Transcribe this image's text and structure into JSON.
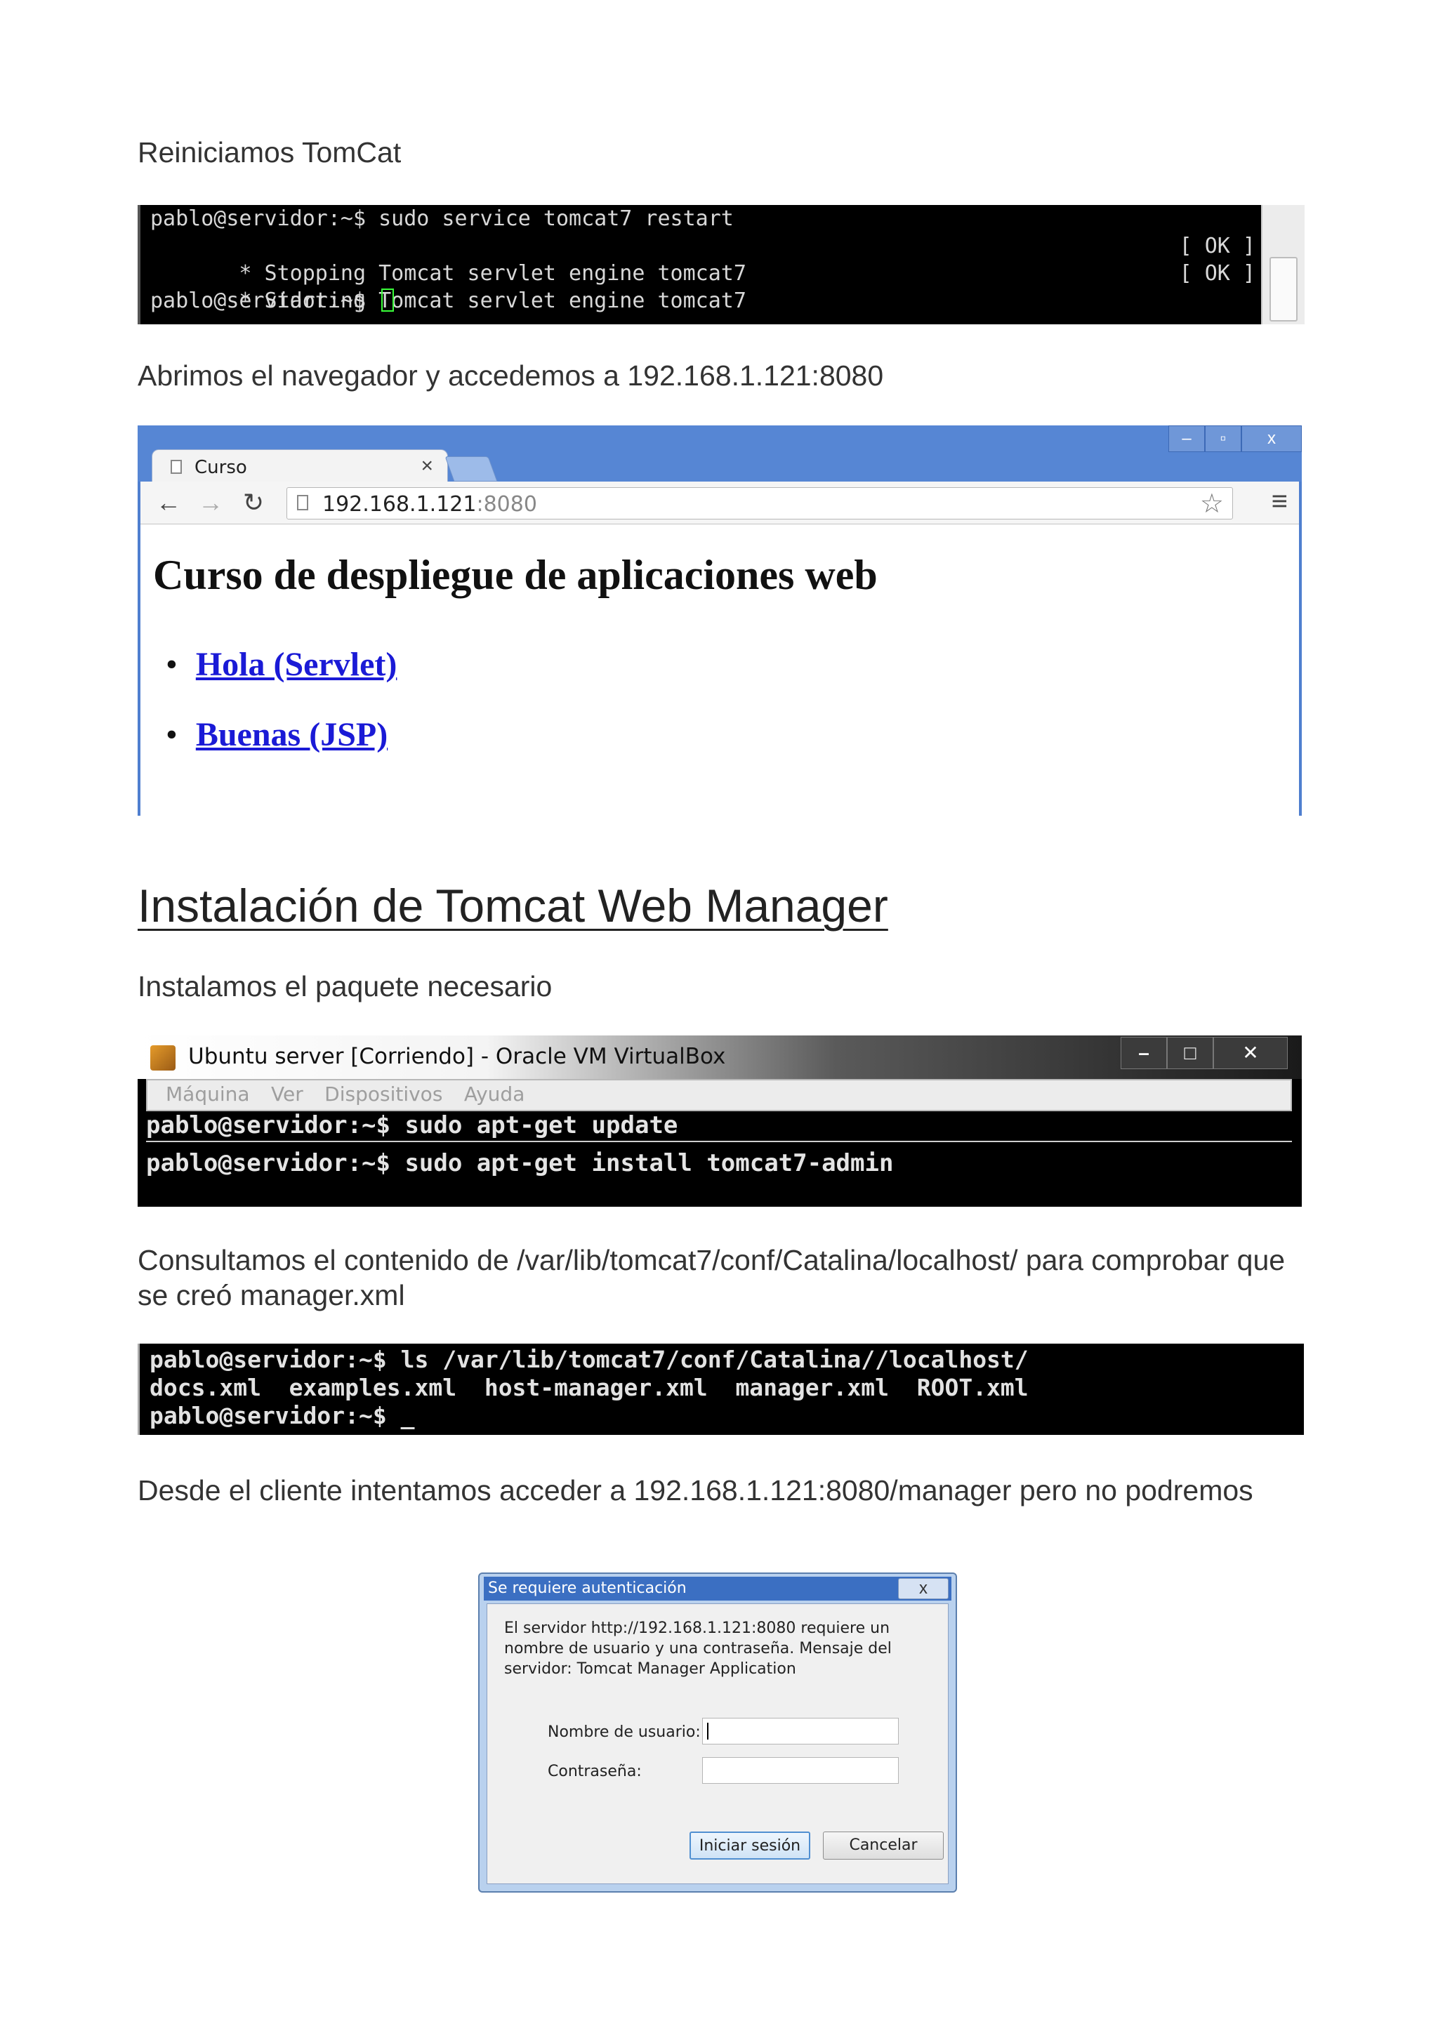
{
  "paragraphs": {
    "p1": "Reiniciamos TomCat",
    "p2": "Abrimos el navegador y accedemos a 192.168.1.121:8080",
    "heading": "Instalación de Tomcat Web Manager",
    "p3": "Instalamos el paquete necesario",
    "p4": "Consultamos el contenido de /var/lib/tomcat7/conf/Catalina/localhost/ para comprobar que se creó manager.xml",
    "p5": "Desde el cliente intentamos acceder a 192.168.1.121:8080/manager pero no podremos"
  },
  "terminal1": {
    "line1": "pablo@servidor:~$ sudo service tomcat7 restart",
    "line2": " * Stopping Tomcat servlet engine tomcat7",
    "line2_status": "[ OK ]",
    "line3": " * Starting Tomcat servlet engine tomcat7",
    "line3_status": "[ OK ]",
    "line4": "pablo@servidor:~$ "
  },
  "browser": {
    "tab_title": "Curso",
    "tab_close": "×",
    "url_host": "192.168.1.121",
    "url_port": ":8080",
    "window_min": "–",
    "window_max": "▫",
    "window_close": "x",
    "page_heading": "Curso de despliegue de aplicaciones web",
    "links": [
      "Hola (Servlet)",
      "Buenas (JSP)"
    ]
  },
  "virtualbox": {
    "title": "Ubuntu server [Corriendo] - Oracle VM VirtualBox",
    "menu": [
      "Máquina",
      "Ver",
      "Dispositivos",
      "Ayuda"
    ],
    "cmd1": "pablo@servidor:~$ sudo apt-get update",
    "cmd2": "pablo@servidor:~$ sudo apt-get install tomcat7-admin"
  },
  "terminal3": {
    "line1": "pablo@servidor:~$ ls /var/lib/tomcat7/conf/Catalina//localhost/",
    "line2": "docs.xml  examples.xml  host-manager.xml  manager.xml  ROOT.xml",
    "line3": "pablo@servidor:~$ _"
  },
  "auth_dialog": {
    "title": "Se requiere autenticación",
    "close": "x",
    "message": "El servidor http://192.168.1.121:8080 requiere un nombre de usuario y una contraseña. Mensaje del servidor: Tomcat Manager Application",
    "user_label": "Nombre de usuario:",
    "password_label": "Contraseña:",
    "login_button": "Iniciar sesión",
    "cancel_button": "Cancelar"
  }
}
